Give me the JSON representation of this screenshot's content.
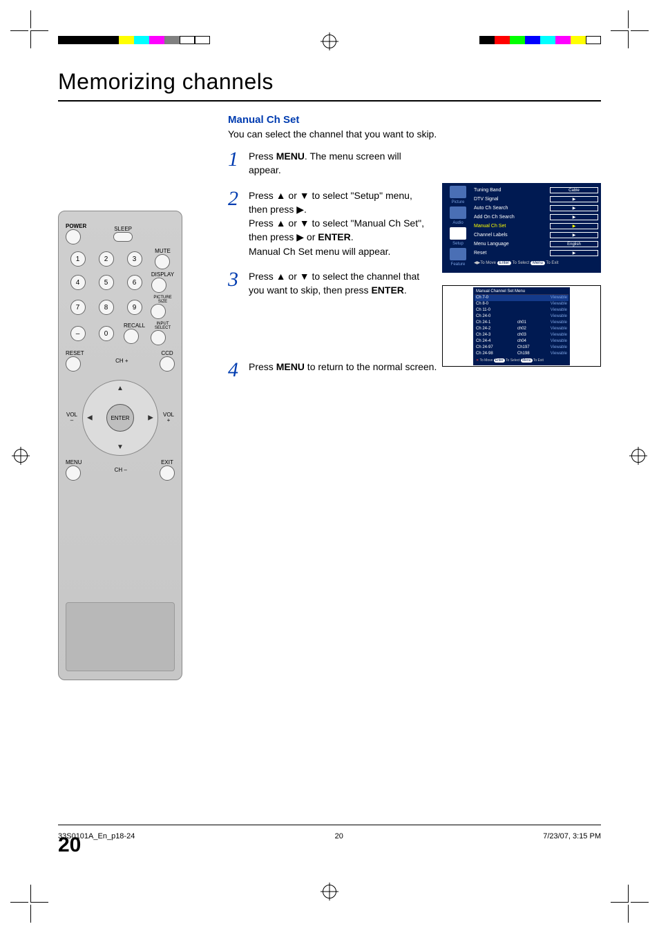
{
  "title": "Memorizing channels",
  "section_head": "Manual Ch Set",
  "intro": "You can select the channel that you want to skip.",
  "steps": [
    {
      "num": "1",
      "html": "Press <b>MENU</b>.  The menu screen will appear."
    },
    {
      "num": "2",
      "html": "Press ▲ or ▼ to select \"Setup\" menu, then press ▶.<br>Press ▲ or ▼ to select \"Manual Ch Set\", then press ▶ or <b>ENTER</b>.<br>Manual Ch Set menu will appear."
    },
    {
      "num": "3",
      "html": "Press ▲ or ▼ to select the channel that you want to skip, then press <b>ENTER</b>."
    },
    {
      "num": "4",
      "html": "Press <b>MENU</b> to return to the normal screen."
    }
  ],
  "remote": {
    "power": "POWER",
    "sleep": "SLEEP",
    "mute": "MUTE",
    "display": "DISPLAY",
    "picsize": "PICTURE SIZE",
    "recall": "RECALL",
    "input": "INPUT SELECT",
    "reset": "RESET",
    "ccd": "CCD",
    "chplus": "CH +",
    "chminus": "CH –",
    "volplus": "VOL\n+",
    "volminus": "VOL\n–",
    "menu": "MENU",
    "exit": "EXIT",
    "enter": "ENTER",
    "digits": [
      "1",
      "2",
      "3",
      "4",
      "5",
      "6",
      "7",
      "8",
      "9",
      "–",
      "0"
    ]
  },
  "osd1": {
    "side": [
      "Picture",
      "Audio",
      "Setup",
      "Feature"
    ],
    "rows": [
      {
        "label": "Tuning Band",
        "val": "Cable"
      },
      {
        "label": "DTV Signal",
        "val": "▶"
      },
      {
        "label": "Auto Ch Search",
        "val": "▶"
      },
      {
        "label": "Add On Ch Search",
        "val": "▶"
      },
      {
        "label": "Manual Ch Set",
        "val": "▶",
        "sel": true
      },
      {
        "label": "Channel Labels",
        "val": "▶"
      },
      {
        "label": "Menu Language",
        "val": "English"
      },
      {
        "label": "Reset",
        "val": "▶"
      }
    ],
    "foot": "◀▶To Move  Enter  To Select  Menu  To Exit"
  },
  "osd2": {
    "title": "Manual Channel Set Menu",
    "rows": [
      {
        "l": "Ch 7-0",
        "m": "",
        "r": "Viewable",
        "sel": true
      },
      {
        "l": "Ch 8-0",
        "m": "",
        "r": "Viewable"
      },
      {
        "l": "Ch 11-0",
        "m": "",
        "r": "Viewable"
      },
      {
        "l": "Ch 24-0",
        "m": "",
        "r": "Viewable"
      },
      {
        "l": "Ch 24-1",
        "m": "ch01",
        "r": "Viewable"
      },
      {
        "l": "Ch 24-2",
        "m": "ch02",
        "r": "Viewable"
      },
      {
        "l": "Ch 24-3",
        "m": "ch03",
        "r": "Viewable"
      },
      {
        "l": "Ch 24-4",
        "m": "ch04",
        "r": "Viewable"
      },
      {
        "l": "Ch 24-97",
        "m": "Ch197",
        "r": "Viewable"
      },
      {
        "l": "Ch 24-98",
        "m": "Ch198",
        "r": "Viewable"
      }
    ],
    "foot": "✕ To Move Enter To Select Menu To Exit"
  },
  "page_num": "20",
  "footer": {
    "left": "33S0101A_En_p18-24",
    "center": "20",
    "right": "7/23/07, 3:15 PM"
  },
  "colors": {
    "bar_left": [
      "#000",
      "#000",
      "#000",
      "#000",
      "#ff0",
      "#0ff",
      "#f0f",
      "#808080",
      "#fff",
      "#fff"
    ],
    "bar_right": [
      "#000",
      "#f00",
      "#0f0",
      "#00f",
      "#0ff",
      "#f0f",
      "#ff0",
      "#fff"
    ]
  }
}
